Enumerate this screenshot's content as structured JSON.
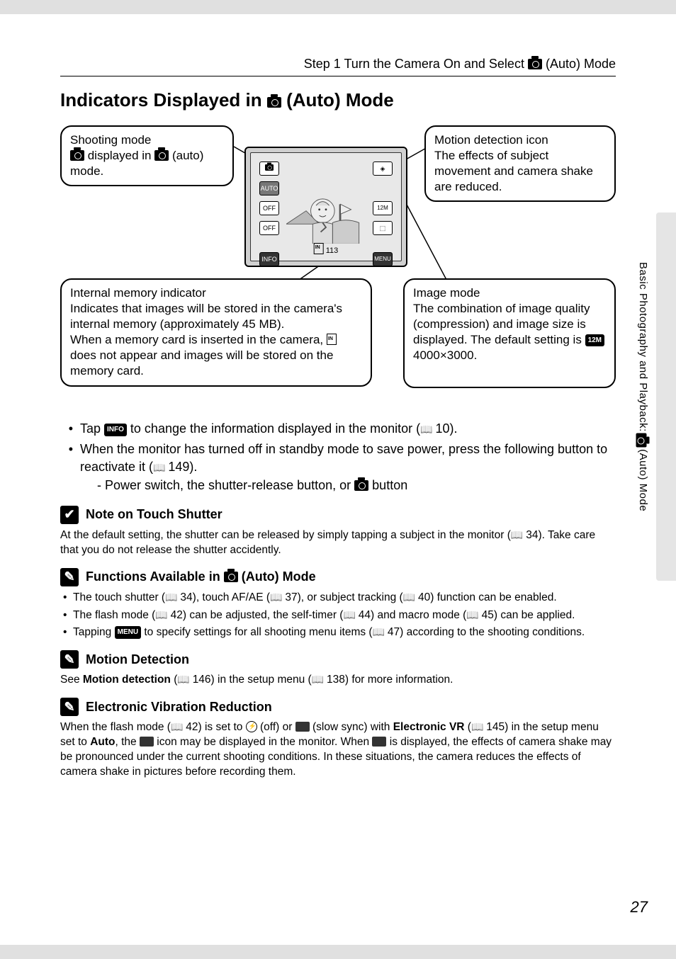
{
  "header": {
    "step_text_pre": "Step 1 Turn the Camera On and Select ",
    "step_text_post": " (Auto) Mode"
  },
  "title": {
    "pre": "Indicators Displayed in ",
    "post": " (Auto) Mode"
  },
  "callouts": {
    "shooting": {
      "title": "Shooting mode",
      "line2_pre": "",
      "line2_mid": " displayed in ",
      "line2_post": " (auto) mode."
    },
    "motion": {
      "title": "Motion detection icon",
      "body": "The effects of subject movement and camera shake are reduced."
    },
    "memory": {
      "title": "Internal memory indicator",
      "p1": "Indicates that images will be stored in the camera's internal memory (approximately 45 MB).",
      "p2_pre": "When a memory card is inserted in the camera, ",
      "p2_post": " does not appear and images will be stored on the memory card."
    },
    "image": {
      "title": "Image mode",
      "body_pre": "The combination of image quality (compression) and image size is displayed. The default setting is ",
      "body_post": " 4000×3000."
    }
  },
  "lcd": {
    "auto": "AUTO",
    "off": "OFF",
    "info": "INFO",
    "twelve": "12M",
    "menu": "MENU",
    "count": "113"
  },
  "bullets": {
    "b1_pre": "Tap ",
    "b1_mid": " to change the information displayed in the monitor (",
    "b1_post": " 10).",
    "b2_pre": "When the monitor has turned off in standby mode to save power, press the following button to reactivate it (",
    "b2_post": " 149).",
    "b2_sub_pre": "Power switch, the shutter-release button, or ",
    "b2_sub_post": " button"
  },
  "note_touch": {
    "title": "Note on Touch Shutter",
    "body_pre": "At the default setting, the shutter can be released by simply tapping a subject in the monitor (",
    "body_post": " 34). Take care that you do not release the shutter accidently."
  },
  "functions": {
    "title_pre": "Functions Available in ",
    "title_post": " (Auto) Mode",
    "f1_pre": "The touch shutter (",
    "f1_mid1": " 34), touch AF/AE (",
    "f1_mid2": " 37), or subject tracking (",
    "f1_post": " 40) function can be enabled.",
    "f2_pre": "The flash mode (",
    "f2_mid1": " 42) can be adjusted, the self-timer (",
    "f2_mid2": " 44) and macro mode (",
    "f2_post": " 45) can be applied.",
    "f3_pre": "Tapping ",
    "f3_mid": " to specify settings for all shooting menu items (",
    "f3_post": " 47) according to the shooting conditions."
  },
  "motion_detect": {
    "title": "Motion Detection",
    "body_pre": "See ",
    "body_bold": "Motion detection",
    "body_mid1": " (",
    "body_mid2": " 146) in the setup menu (",
    "body_post": " 138) for more information."
  },
  "evr": {
    "title": "Electronic Vibration Reduction",
    "p_pre": "When the flash mode (",
    "p_1": " 42) is set to ",
    "p_2": " (off) or ",
    "p_3": " (slow sync) with ",
    "p_bold": "Electronic VR",
    "p_4": " (",
    "p_5": " 145) in the setup menu set to ",
    "p_bold2": "Auto",
    "p_6": ", the ",
    "p_7": " icon may be displayed in the monitor. When ",
    "p_8": " is displayed, the effects of camera shake may be pronounced under the current shooting conditions. In these situations, the camera reduces the effects of camera shake in pictures before recording them."
  },
  "side_label_pre": "Basic Photography and Playback: ",
  "side_label_post": " (Auto) Mode",
  "page_number": "27",
  "pill_info": "INFO",
  "pill_menu": "MENU",
  "pill_12m": "12M"
}
